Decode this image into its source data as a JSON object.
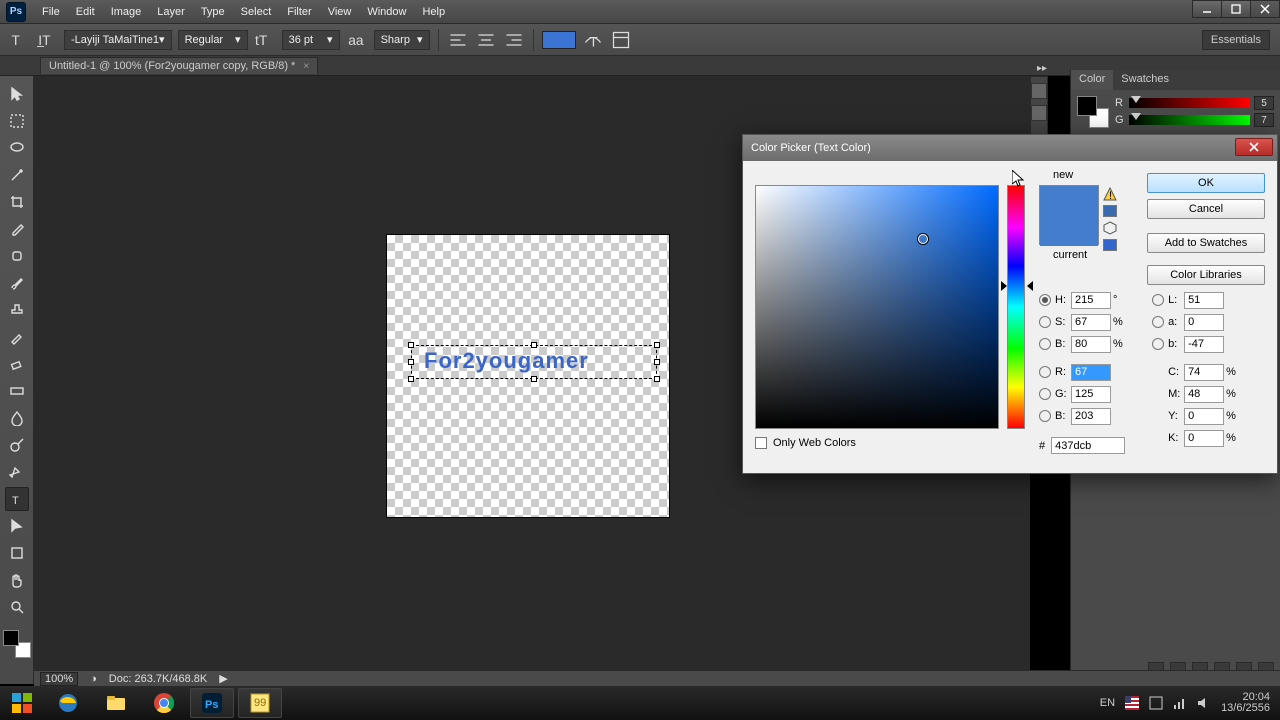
{
  "menus": {
    "file": "File",
    "edit": "Edit",
    "image": "Image",
    "layer": "Layer",
    "type": "Type",
    "select": "Select",
    "filter": "Filter",
    "view": "View",
    "window": "Window",
    "help": "Help"
  },
  "workspace_label": "Essentials",
  "optbar": {
    "font": "-Layiji TaMaiTine1",
    "style": "Regular",
    "size": "36 pt",
    "aa": "Sharp"
  },
  "doc_tab": "Untitled-1 @ 100% (For2yougamer copy, RGB/8) *",
  "canvas_text": "For2yougamer",
  "status": {
    "zoom": "100%",
    "doc": "Doc: 263.7K/468.8K"
  },
  "color_panel": {
    "tabs": {
      "color": "Color",
      "swatches": "Swatches"
    },
    "r_label": "R",
    "r_val": "5",
    "g_label": "G",
    "g_val": "7"
  },
  "dialog": {
    "title": "Color Picker (Text Color)",
    "new_label": "new",
    "current_label": "current",
    "ok": "OK",
    "cancel": "Cancel",
    "add": "Add to Swatches",
    "lib": "Color Libraries",
    "only_web": "Only Web Colors",
    "hsb": {
      "h_lab": "H:",
      "h": "215",
      "h_u": "°",
      "s_lab": "S:",
      "s": "67",
      "s_u": "%",
      "b_lab": "B:",
      "b": "80",
      "b_u": "%"
    },
    "lab": {
      "l_lab": "L:",
      "l": "51",
      "a_lab": "a:",
      "a": "0",
      "b_lab": "b:",
      "b": "-47"
    },
    "rgb": {
      "r_lab": "R:",
      "r": "67",
      "g_lab": "G:",
      "g": "125",
      "b_lab": "B:",
      "b": "203"
    },
    "cmyk": {
      "c_lab": "C:",
      "c": "74",
      "m_lab": "M:",
      "m": "48",
      "y_lab": "Y:",
      "y": "0",
      "k_lab": "K:",
      "k": "0",
      "u": "%"
    },
    "hex_lab": "#",
    "hex": "437dcb"
  },
  "tray": {
    "lang": "EN",
    "time": "20:04",
    "date": "13/6/2556"
  }
}
